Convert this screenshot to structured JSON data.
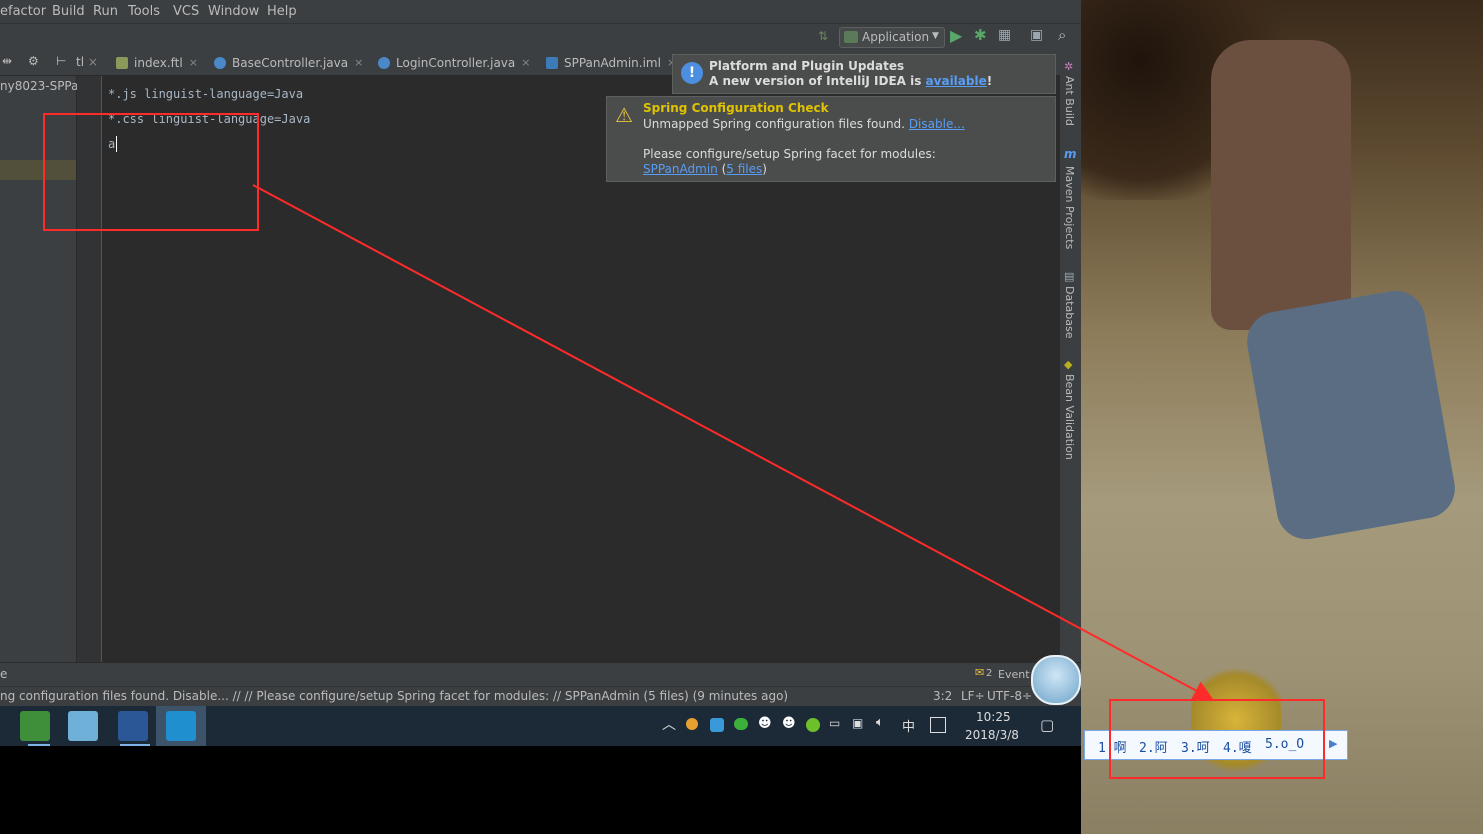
{
  "menu": [
    "efactor",
    "Build",
    "Run",
    "Tools",
    "VCS",
    "Window",
    "Help"
  ],
  "run_config": {
    "label": "Application"
  },
  "tabs": [
    {
      "label": "index.ftl"
    },
    {
      "label": "BaseController.java"
    },
    {
      "label": "LoginController.java"
    },
    {
      "label": "SPPanAdmin.iml"
    }
  ],
  "project_panel": {
    "root_label": "ny8023-SPPan"
  },
  "editor": {
    "lines": [
      "*.js linguist-language=Java",
      "*.css linguist-language=Java",
      "a"
    ]
  },
  "notifications": {
    "platform": {
      "title": "Platform and Plugin Updates",
      "text_prefix": "A new version of IntelliJ IDEA is ",
      "link": "available",
      "suffix": "!"
    },
    "spring": {
      "title": "Spring Configuration Check",
      "line1": "Unmapped Spring configuration files found. ",
      "disable_link": "Disable...",
      "line2": "Please configure/setup Spring facet for modules:",
      "module_link": "SPPanAdmin",
      "paren_open": " (",
      "files_link": "5 files",
      "paren_close": ")"
    }
  },
  "right_tools": [
    "Ant Build",
    "Maven Projects",
    "Database",
    "Bean Validation"
  ],
  "bottom_bar": {
    "left_text": "e",
    "event_badge": "2",
    "event_label": "Event"
  },
  "status": {
    "message": "ng configuration files found. Disable... // // Please configure/setup Spring facet for modules: // SPPanAdmin (5 files) (9 minutes ago)",
    "position": "3:2",
    "line_sep": "LF÷",
    "encoding": "UTF-8÷"
  },
  "taskbar": {
    "time": "10:25",
    "date": "2018/3/8",
    "ime_indicator": "中"
  },
  "ime_candidates": [
    "1.啊",
    "2.阿",
    "3.呵",
    "4.嗄",
    "5.o_O"
  ],
  "colors": {
    "accent_red": "#ff2a2a",
    "link_blue": "#589df6",
    "spring_title": "#e0c300"
  }
}
